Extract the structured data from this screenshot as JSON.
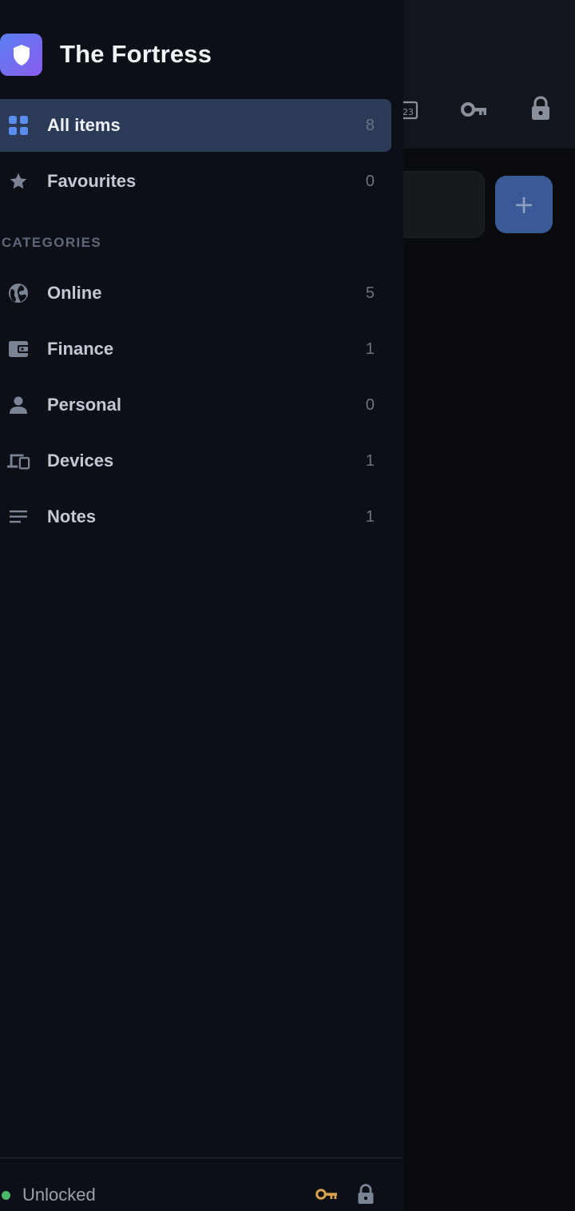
{
  "app": {
    "title": "The Fortress"
  },
  "background": {
    "calendar_icon_text": "23",
    "add_button_label": "+"
  },
  "drawer": {
    "items": [
      {
        "label": "All items",
        "count": "8",
        "icon": "grid-icon",
        "active": true
      },
      {
        "label": "Favourites",
        "count": "0",
        "icon": "star-icon",
        "active": false
      }
    ],
    "categories_header": "CATEGORIES",
    "categories": [
      {
        "label": "Online",
        "count": "5",
        "icon": "globe-icon"
      },
      {
        "label": "Finance",
        "count": "1",
        "icon": "wallet-icon"
      },
      {
        "label": "Personal",
        "count": "0",
        "icon": "person-icon"
      },
      {
        "label": "Devices",
        "count": "1",
        "icon": "devices-icon"
      },
      {
        "label": "Notes",
        "count": "1",
        "icon": "notes-icon"
      }
    ]
  },
  "footer": {
    "status": "Unlocked",
    "status_color": "#4ab868"
  },
  "colors": {
    "accent": "#5b8def",
    "active_bg": "#2b3a57",
    "key_footer": "#d6a24e"
  }
}
